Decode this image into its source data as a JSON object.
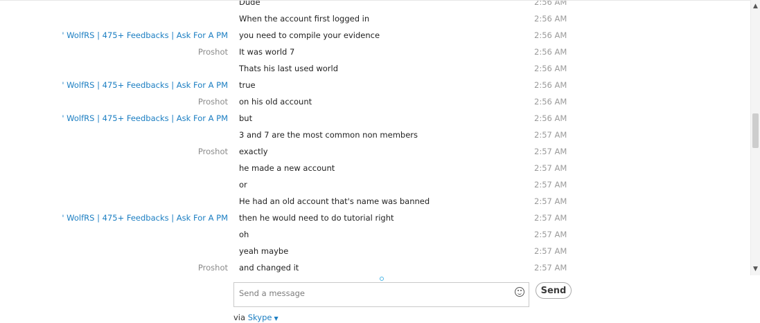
{
  "messages": [
    {
      "sender": "",
      "sender_type": "none",
      "text": "Dude",
      "time": "2:56 AM"
    },
    {
      "sender": "",
      "sender_type": "none",
      "text": "When the account first logged in",
      "time": "2:56 AM"
    },
    {
      "sender": "' WolfRS | 475+ Feedbacks | Ask For A PM",
      "sender_type": "wolf",
      "text": "you need to compile your evidence",
      "time": "2:56 AM"
    },
    {
      "sender": "Proshot",
      "sender_type": "proshot",
      "text": "It was world 7",
      "time": "2:56 AM"
    },
    {
      "sender": "",
      "sender_type": "none",
      "text": "Thats his last used world",
      "time": "2:56 AM"
    },
    {
      "sender": "' WolfRS | 475+ Feedbacks | Ask For A PM",
      "sender_type": "wolf",
      "text": "true",
      "time": "2:56 AM"
    },
    {
      "sender": "Proshot",
      "sender_type": "proshot",
      "text": "on his old account",
      "time": "2:56 AM"
    },
    {
      "sender": "' WolfRS | 475+ Feedbacks | Ask For A PM",
      "sender_type": "wolf",
      "text": "but",
      "time": "2:56 AM"
    },
    {
      "sender": "",
      "sender_type": "none",
      "text": "3 and 7 are the most common non members",
      "time": "2:57 AM"
    },
    {
      "sender": "Proshot",
      "sender_type": "proshot",
      "text": "exactly",
      "time": "2:57 AM"
    },
    {
      "sender": "",
      "sender_type": "none",
      "text": "he made a new account",
      "time": "2:57 AM"
    },
    {
      "sender": "",
      "sender_type": "none",
      "text": "or",
      "time": "2:57 AM"
    },
    {
      "sender": "",
      "sender_type": "none",
      "text": "He had an old account that's name was banned",
      "time": "2:57 AM"
    },
    {
      "sender": "' WolfRS | 475+ Feedbacks | Ask For A PM",
      "sender_type": "wolf",
      "text": "then he would need to do tutorial right",
      "time": "2:57 AM"
    },
    {
      "sender": "",
      "sender_type": "none",
      "text": "oh",
      "time": "2:57 AM"
    },
    {
      "sender": "",
      "sender_type": "none",
      "text": "yeah maybe",
      "time": "2:57 AM"
    },
    {
      "sender": "Proshot",
      "sender_type": "proshot",
      "text": "and changed it",
      "time": "2:57 AM"
    }
  ],
  "composer": {
    "placeholder": "Send a message",
    "emoticon_icon": "smiley-icon",
    "send_label": "Send"
  },
  "footer": {
    "via_label": "via",
    "service_link": "Skype",
    "caret_icon": "chevron-down-icon"
  },
  "colors": {
    "sender_link": "#1b7ec2",
    "sender_muted": "#8a8a8a",
    "timestamp": "#9a9a9a"
  }
}
